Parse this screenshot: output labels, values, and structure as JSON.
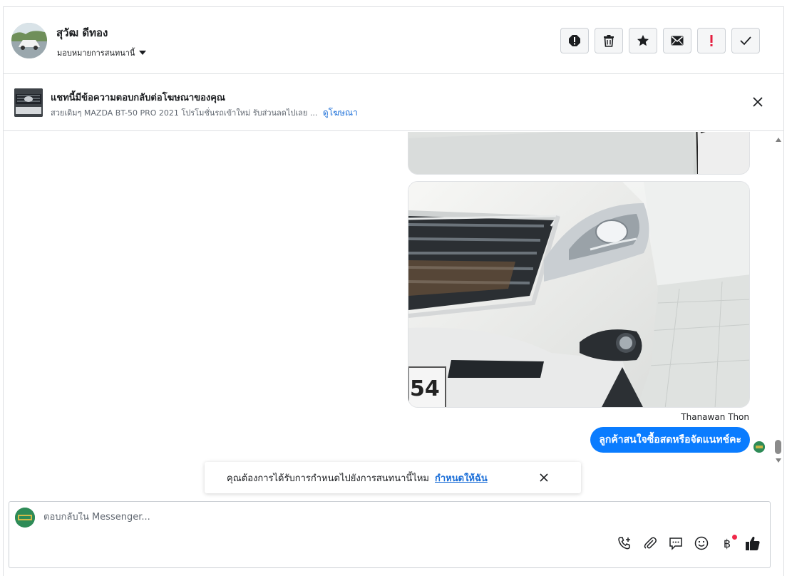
{
  "header": {
    "contact_name": "สุวัฒ ดีทอง",
    "assign_label": "มอบหมายการสนทนานี้",
    "actions": [
      {
        "name": "report-spam-icon"
      },
      {
        "name": "trash-icon"
      },
      {
        "name": "star-icon"
      },
      {
        "name": "envelope-icon"
      },
      {
        "name": "exclamation-icon",
        "color": "#e41e3f"
      },
      {
        "name": "checkmark-icon"
      }
    ]
  },
  "ad_banner": {
    "title": "แชทนี้มีข้อความตอบกลับต่อโฆษณาของคุณ",
    "description": "สวยเดิมๆ MAZDA BT-50 PRO 2021 โปรโมชั่นรถเข้าใหม่ รับส่วนลดไปเลย ...",
    "link": "ดูโฆษณา"
  },
  "messages": {
    "sender_name": "Thanawan Thon",
    "last_message": "ลูกค้าสนใจซื้อสดหรือจัดแนทช์คะ",
    "plate_text": "54"
  },
  "toast": {
    "text": "คุณต้องการได้รับการกำหนดไปยังการสนทนานี้ไหม",
    "link": "กำหนดให้ฉัน"
  },
  "composer": {
    "placeholder": "ตอบกลับใน Messenger...",
    "currency_symbol": "฿"
  },
  "colors": {
    "accent": "#0a7cff",
    "link": "#1a6ed8",
    "danger": "#e41e3f"
  }
}
